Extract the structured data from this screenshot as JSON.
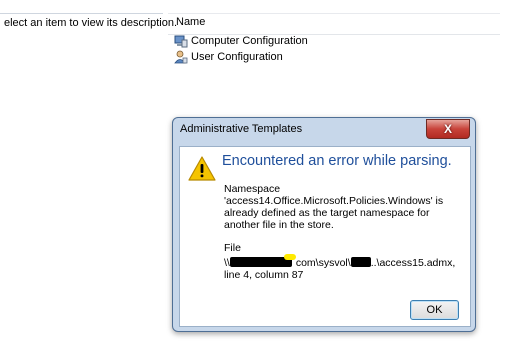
{
  "description_pane": {
    "text": "elect an item to view its description."
  },
  "list": {
    "column_name": "Name",
    "items": [
      {
        "label": "Computer Configuration",
        "icon": "computer-config-icon"
      },
      {
        "label": "User Configuration",
        "icon": "user-config-icon"
      }
    ]
  },
  "dialog": {
    "title": "Administrative Templates",
    "close_label": "X",
    "heading": "Encountered an error while parsing.",
    "message": "Namespace 'access14.Office.Microsoft.Policies.Windows' is already defined as the target namespace for another file in the store.",
    "file_label": "File",
    "file_path_host_suffix": "com\\sysvol\\",
    "file_path_tail": "..\\access15.admx,",
    "file_location": "line 4, column 87",
    "ok_label": "OK"
  },
  "colors": {
    "heading": "#1f4f9b",
    "dialog_frame": "#c7d7ea",
    "warning_yellow": "#f5c400"
  }
}
